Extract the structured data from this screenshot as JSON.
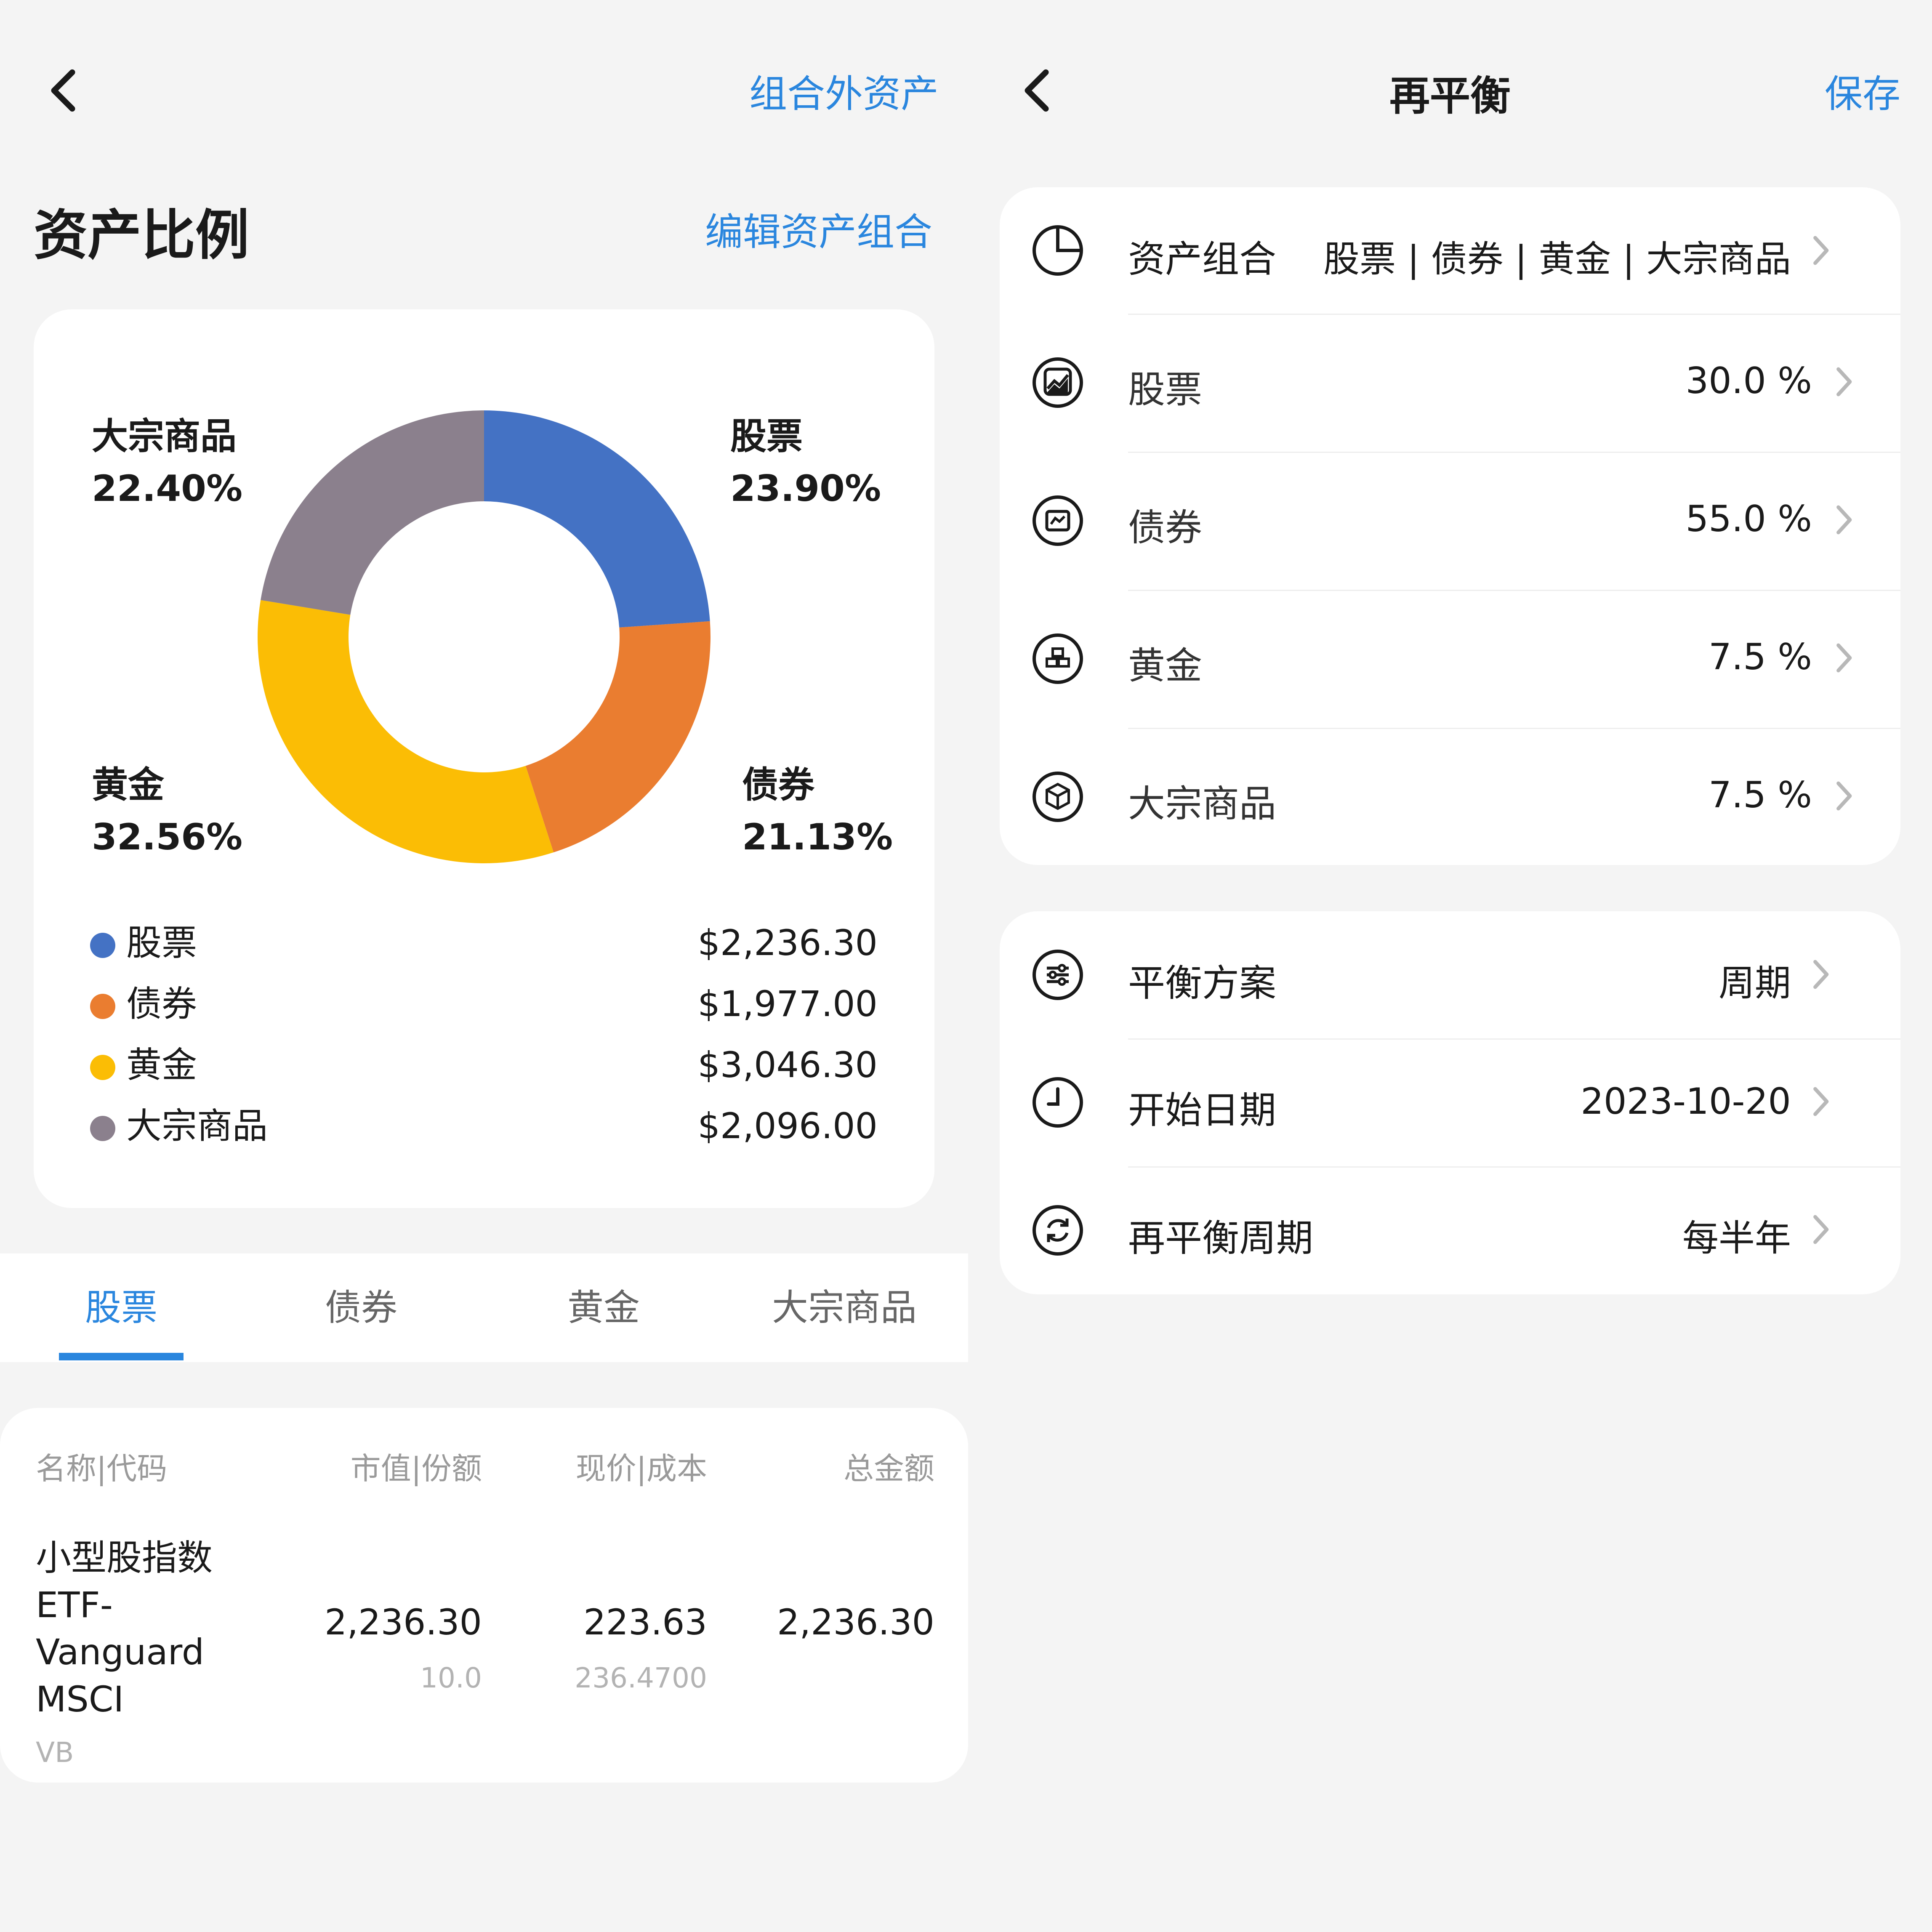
{
  "left": {
    "header": {
      "right_link": "组合外资产"
    },
    "section_title": "资产比例",
    "edit_link": "编辑资产组合",
    "chart_data": {
      "type": "pie",
      "categories": [
        "股票",
        "债券",
        "黄金",
        "大宗商品"
      ],
      "values": [
        23.9,
        21.13,
        32.56,
        22.4
      ],
      "value_labels": [
        "23.90%",
        "21.13%",
        "32.56%",
        "22.40%"
      ],
      "colors": [
        "#4472c4",
        "#ea7d30",
        "#fbbd05",
        "#8b808d"
      ],
      "donut": true
    },
    "legend": [
      {
        "name": "股票",
        "value": "$2,236.30",
        "color": "#4472c4"
      },
      {
        "name": "债券",
        "value": "$1,977.00",
        "color": "#ea7d30"
      },
      {
        "name": "黄金",
        "value": "$3,046.30",
        "color": "#fbbd05"
      },
      {
        "name": "大宗商品",
        "value": "$2,096.00",
        "color": "#8b808d"
      }
    ],
    "tabs": [
      "股票",
      "债券",
      "黄金",
      "大宗商品"
    ],
    "table": {
      "headers": [
        "名称|代码",
        "市值|份额",
        "现价|成本",
        "总金额"
      ],
      "row": {
        "name_lines": [
          "小型股指数",
          "ETF-",
          "Vanguard",
          "MSCI"
        ],
        "code": "VB",
        "market_value": "2,236.30",
        "shares": "10.0",
        "price": "223.63",
        "cost": "236.4700",
        "total": "2,236.30"
      }
    }
  },
  "right": {
    "header": {
      "title": "再平衡",
      "save": "保存"
    },
    "card1": [
      {
        "icon": "pie-chart-icon",
        "label": "资产组合",
        "value": "股票 | 债券 | 黄金 | 大宗商品"
      },
      {
        "icon": "stock-chart-icon",
        "label": "股票",
        "value": "30.0 %"
      },
      {
        "icon": "bond-icon",
        "label": "债券",
        "value": "55.0 %"
      },
      {
        "icon": "gold-bars-icon",
        "label": "黄金",
        "value": "7.5 %"
      },
      {
        "icon": "commodity-box-icon",
        "label": "大宗商品",
        "value": "7.5 %"
      }
    ],
    "card2": [
      {
        "icon": "sliders-icon",
        "label": "平衡方案",
        "value": "周期"
      },
      {
        "icon": "clock-icon",
        "label": "开始日期",
        "value": "2023-10-20"
      },
      {
        "icon": "refresh-icon",
        "label": "再平衡周期",
        "value": "每半年"
      }
    ]
  }
}
